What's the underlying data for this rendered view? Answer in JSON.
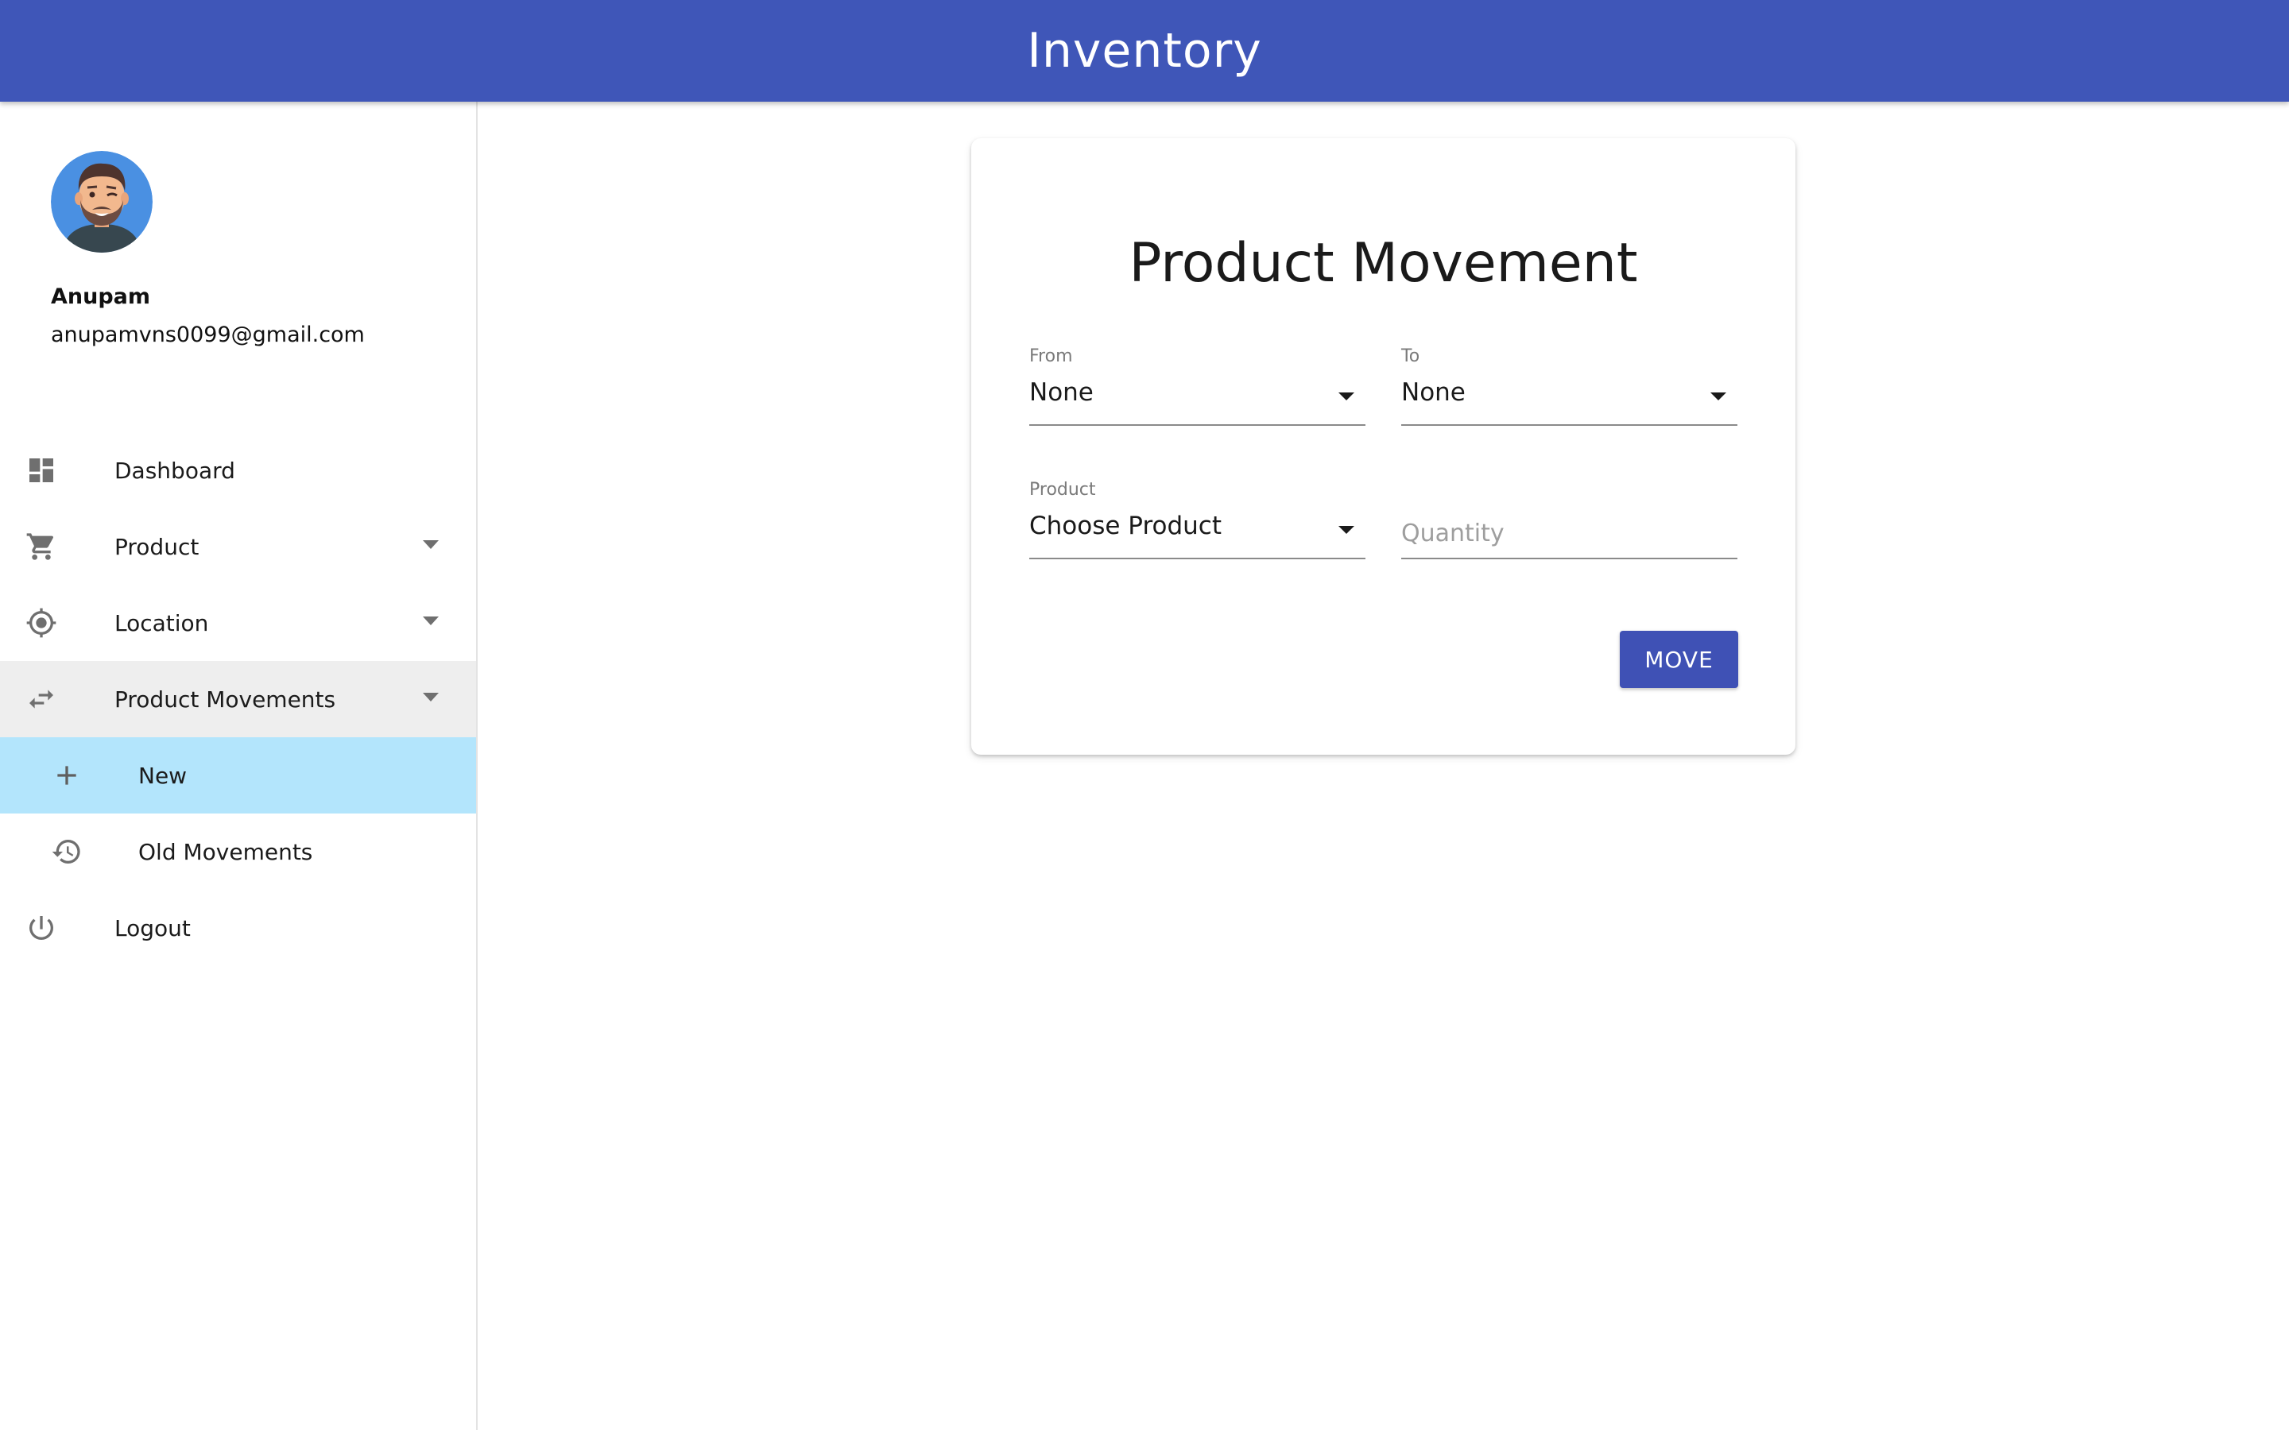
{
  "header": {
    "title": "Inventory"
  },
  "user": {
    "name": "Anupam",
    "email": "anupamvns0099@gmail.com"
  },
  "sidebar": {
    "items": [
      {
        "label": "Dashboard",
        "icon": "dashboard-icon"
      },
      {
        "label": "Product",
        "icon": "cart-icon",
        "expandable": true
      },
      {
        "label": "Location",
        "icon": "location-icon",
        "expandable": true
      },
      {
        "label": "Product Movements",
        "icon": "swap-icon",
        "expandable": true,
        "expanded": true
      },
      {
        "label": "New",
        "icon": "plus-icon",
        "sub": true,
        "active": true
      },
      {
        "label": "Old Movements",
        "icon": "history-icon",
        "sub": true
      },
      {
        "label": "Logout",
        "icon": "power-icon"
      }
    ]
  },
  "form": {
    "title": "Product Movement",
    "from": {
      "label": "From",
      "value": "None"
    },
    "to": {
      "label": "To",
      "value": "None"
    },
    "product": {
      "label": "Product",
      "value": "Choose Product"
    },
    "quantity": {
      "placeholder": "Quantity",
      "value": ""
    },
    "submit_label": "MOVE"
  },
  "colors": {
    "header_bg": "#3f56b8",
    "button_bg": "#3f51b5",
    "active_item_bg": "#b3e5fc",
    "expanded_item_bg": "#eeeeee"
  }
}
